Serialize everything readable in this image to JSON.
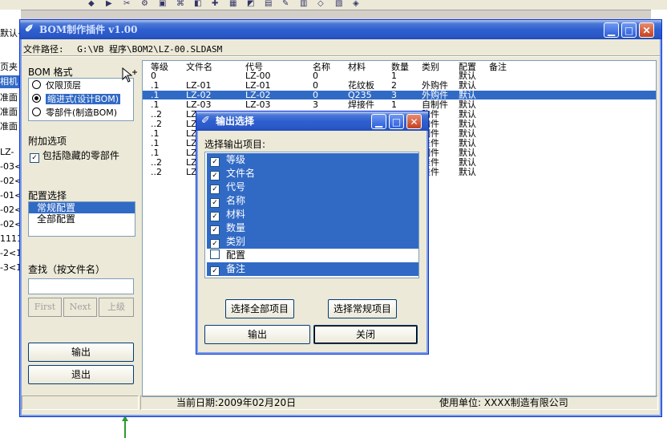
{
  "host": {
    "left_rows": [
      "默认<",
      "页夹",
      "相机",
      "准面",
      "准面",
      "准面",
      "LZ-",
      "-03<",
      "-02<",
      "-01<",
      "-02<",
      "-02<",
      "1111",
      "-2<1",
      "-3<1"
    ],
    "left_highlight_index": 2,
    "toolbar_glyphs": [
      "◆",
      "▶",
      "✂",
      "⚙",
      "▣",
      "⌘",
      "◧",
      "✚",
      "▦",
      "◩",
      "▤",
      "✎",
      "▥",
      "◇",
      "▧",
      "◈"
    ]
  },
  "main": {
    "title": "BOM制作插件 v1.00",
    "path_label": "文件路径:",
    "path_value": "G:\\VB 程序\\BOM2\\LZ-00.SLDASM",
    "bom_format_label": "BOM 格式",
    "radio_options": [
      {
        "label": "仅限顶层",
        "selected": false
      },
      {
        "label": "缩进式(设计BOM)",
        "selected": true
      },
      {
        "label": "零部件(制造BOM)",
        "selected": false
      }
    ],
    "extra_label": "附加选项",
    "extra_checkbox_label": "包括隐藏的零部件",
    "extra_checked": true,
    "config_label": "配置选择",
    "config_items": [
      {
        "label": "常规配置",
        "selected": true
      },
      {
        "label": "全部配置",
        "selected": false
      }
    ],
    "search_label": "查找（按文件名）",
    "search_value": "",
    "nav_first": "First",
    "nav_next": "Next",
    "nav_up": "上级",
    "output_button": "输出",
    "exit_button": "退出",
    "table": {
      "headers": [
        "等级",
        "文件名",
        "代号",
        "名称",
        "材料",
        "数量",
        "类别",
        "配置",
        "备注"
      ],
      "rows": [
        [
          "0",
          "",
          "LZ-00",
          "0",
          "",
          "1",
          "",
          "默认",
          ""
        ],
        [
          ".1",
          "LZ-01",
          "LZ-01",
          "0",
          "花纹板",
          "2",
          "外购件",
          "默认",
          ""
        ],
        [
          ".1",
          "LZ-02",
          "LZ-02",
          "0",
          "Q235",
          "3",
          "外购件",
          "默认",
          ""
        ],
        [
          ".1",
          "LZ-03",
          "LZ-03",
          "3",
          "焊接件",
          "1",
          "自制件",
          "默认",
          ""
        ],
        [
          "..2",
          "LZ",
          "",
          "",
          "",
          "",
          "购件",
          "默认",
          ""
        ],
        [
          "..2",
          "LZ",
          "",
          "",
          "",
          "",
          "购件",
          "默认",
          ""
        ],
        [
          ".1",
          "LZ",
          "",
          "",
          "",
          "",
          "制件",
          "默认",
          ""
        ],
        [
          ".1",
          "LZ",
          "",
          "",
          "",
          "",
          "准件",
          "默认",
          ""
        ],
        [
          ".1",
          "LZ",
          "",
          "",
          "",
          "",
          "制件",
          "默认",
          ""
        ],
        [
          "..2",
          "LZ",
          "",
          "",
          "",
          "",
          "准件",
          "默认",
          ""
        ],
        [
          "..2",
          "LZ",
          "",
          "",
          "",
          "",
          "准件",
          "默认",
          ""
        ]
      ],
      "selected_row": 2
    },
    "status_date": "当前日期:2009年02月20日",
    "status_company": "使用单位: XXXX制造有限公司"
  },
  "dialog": {
    "title": "输出选择",
    "label": "选择输出项目:",
    "items": [
      {
        "label": "等级",
        "checked": true,
        "selected": true
      },
      {
        "label": "文件名",
        "checked": true,
        "selected": true
      },
      {
        "label": "代号",
        "checked": true,
        "selected": true
      },
      {
        "label": "名称",
        "checked": true,
        "selected": true
      },
      {
        "label": "材料",
        "checked": true,
        "selected": true
      },
      {
        "label": "数量",
        "checked": true,
        "selected": true
      },
      {
        "label": "类别",
        "checked": true,
        "selected": true
      },
      {
        "label": "配置",
        "checked": false,
        "selected": false
      },
      {
        "label": "备注",
        "checked": true,
        "selected": true
      }
    ],
    "select_all_button": "选择全部项目",
    "select_common_button": "选择常规项目",
    "output_button": "输出",
    "close_button": "关闭"
  },
  "colors": {
    "selection": "#316ac5",
    "title_bar": "#2f5fd0",
    "window_face": "#ece9d8",
    "green_arrow": "#2e9b2e"
  }
}
